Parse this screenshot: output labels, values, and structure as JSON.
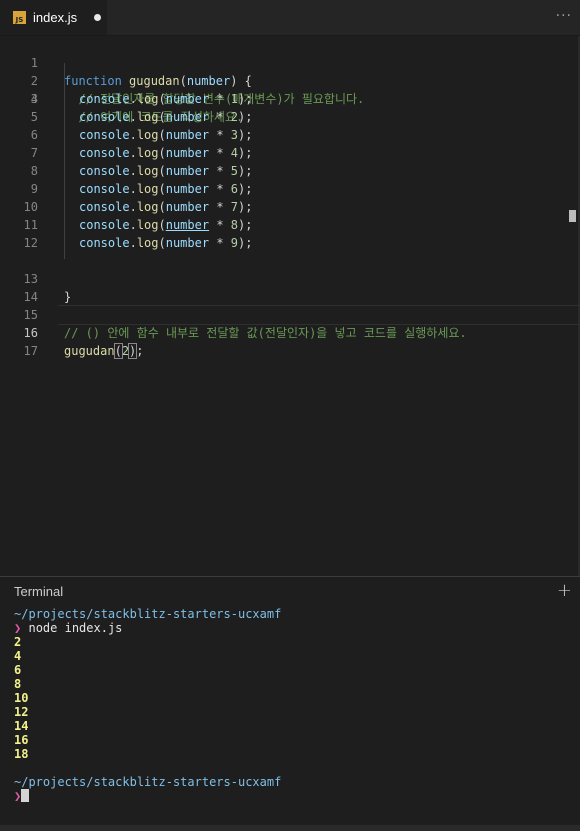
{
  "tab": {
    "icon_text": "JS",
    "label": "index.js",
    "dirty": true
  },
  "editor": {
    "lines": [
      {
        "no": "1"
      },
      {
        "no": "2"
      },
      {
        "no": "3"
      },
      {
        "no": "4"
      },
      {
        "no": "5"
      },
      {
        "no": "6"
      },
      {
        "no": "7"
      },
      {
        "no": "8"
      },
      {
        "no": "9"
      },
      {
        "no": "10"
      },
      {
        "no": "11"
      },
      {
        "no": "12"
      },
      {
        "no": "13"
      },
      {
        "no": "14"
      },
      {
        "no": "15"
      },
      {
        "no": "16"
      },
      {
        "no": "17"
      }
    ],
    "line1": {
      "kw": "function",
      "fn": "gugudan",
      "open": "(",
      "param": "number",
      "close": ") {"
    },
    "line2": "  // 전달인자를 할당할 변수(매개변수)가 필요합니다.",
    "line3": "  // 여기에 코드를 작성하세요.",
    "console_obj": "console",
    "console_dot": ".",
    "console_fn": "log",
    "open_paren": "(",
    "number_var": "number",
    "times": " * ",
    "log_args": [
      "1",
      "2",
      "3",
      "4",
      "5",
      "6",
      "7",
      "8",
      "9"
    ],
    "close": ");",
    "line13": "}",
    "line15": "// () 안에 함수 내부로 전달할 값(전달인자)을 넣고 코드를 실행하세요.",
    "line16": {
      "fn": "gugudan",
      "open": "(",
      "arg": "2",
      "close_paren": ")",
      "semi": ";"
    }
  },
  "terminal": {
    "title": "Terminal",
    "path": "~/projects/stackblitz-starters-ucxamf",
    "prompt_symbol": "❯",
    "command": "node index.js",
    "outputs": [
      "2",
      "4",
      "6",
      "8",
      "10",
      "12",
      "14",
      "16",
      "18"
    ]
  }
}
